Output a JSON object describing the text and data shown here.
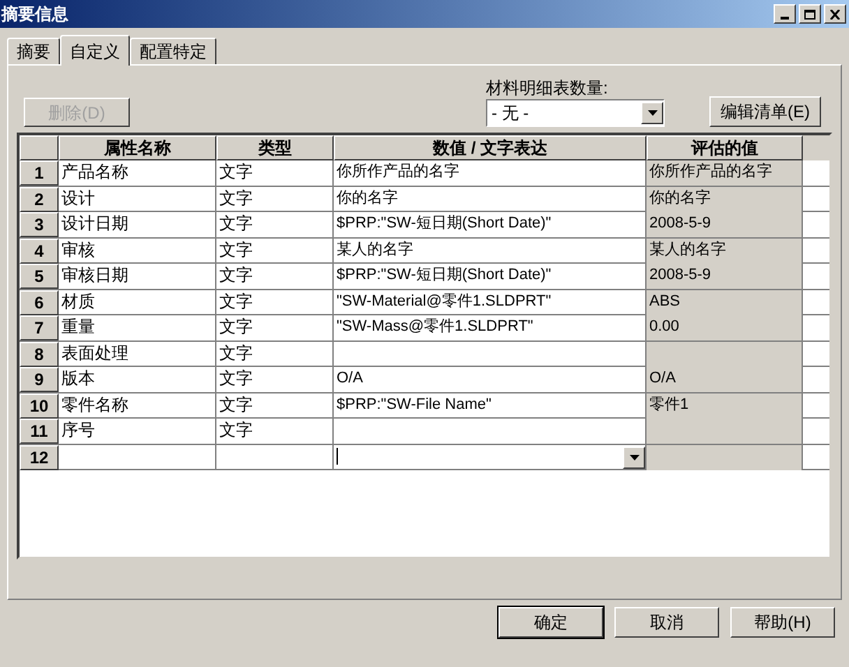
{
  "window": {
    "title": "摘要信息"
  },
  "tabs": [
    {
      "label": "摘要",
      "selected": false
    },
    {
      "label": "自定义",
      "selected": true
    },
    {
      "label": "配置特定",
      "selected": false
    }
  ],
  "delete_button": {
    "label": "删除(D)",
    "disabled": true
  },
  "bom_quantity": {
    "label": "材料明细表数量:",
    "value": "- 无 -"
  },
  "edit_list_button": {
    "label": "编辑清单(E)"
  },
  "table": {
    "columns": [
      "属性名称",
      "类型",
      "数值 / 文字表达",
      "评估的值"
    ],
    "rows": [
      {
        "number": "1",
        "name": "产品名称",
        "type": "文字",
        "value": "你所作产品的名字",
        "evaluated": "你所作产品的名字",
        "editing": false
      },
      {
        "number": "2",
        "name": "设计",
        "type": "文字",
        "value": "你的名字",
        "evaluated": "你的名字",
        "editing": false
      },
      {
        "number": "3",
        "name": "设计日期",
        "type": "文字",
        "value": "$PRP:\"SW-短日期(Short Date)\"",
        "evaluated": "2008-5-9",
        "editing": false
      },
      {
        "number": "4",
        "name": "审核",
        "type": "文字",
        "value": "某人的名字",
        "evaluated": "某人的名字",
        "editing": false
      },
      {
        "number": "5",
        "name": "审核日期",
        "type": "文字",
        "value": "$PRP:\"SW-短日期(Short Date)\"",
        "evaluated": "2008-5-9",
        "editing": false
      },
      {
        "number": "6",
        "name": "材质",
        "type": "文字",
        "value": "\"SW-Material@零件1.SLDPRT\"",
        "evaluated": "ABS",
        "editing": false
      },
      {
        "number": "7",
        "name": "重量",
        "type": "文字",
        "value": "\"SW-Mass@零件1.SLDPRT\"",
        "evaluated": "0.00",
        "editing": false
      },
      {
        "number": "8",
        "name": "表面处理",
        "type": "文字",
        "value": "",
        "evaluated": "",
        "editing": false
      },
      {
        "number": "9",
        "name": "版本",
        "type": "文字",
        "value": "O/A",
        "evaluated": "O/A",
        "editing": false
      },
      {
        "number": "10",
        "name": "零件名称",
        "type": "文字",
        "value": "$PRP:\"SW-File Name\"",
        "evaluated": "零件1",
        "editing": false
      },
      {
        "number": "11",
        "name": "序号",
        "type": "文字",
        "value": "",
        "evaluated": "",
        "editing": false
      },
      {
        "number": "12",
        "name": "",
        "type": "",
        "value": "",
        "evaluated": "",
        "editing": true
      }
    ]
  },
  "buttons": [
    {
      "label": "确定"
    },
    {
      "label": "取消"
    },
    {
      "label": "帮助(H)"
    }
  ]
}
